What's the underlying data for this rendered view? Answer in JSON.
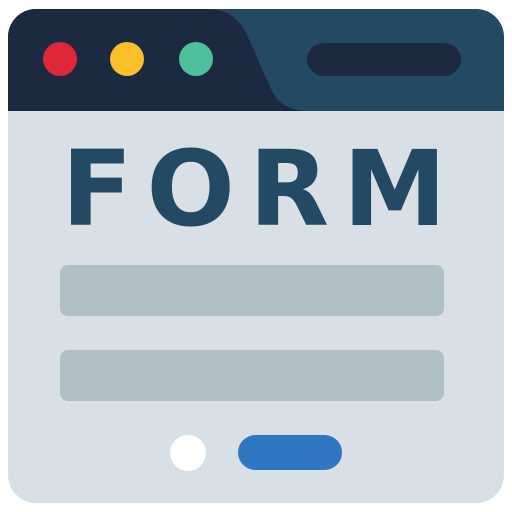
{
  "window": {
    "title": "FORM",
    "colors": {
      "body": "#d8e0e6",
      "titlebar_dark": "#1b2a40",
      "titlebar_light": "#234a62",
      "title_text": "#234a62",
      "field": "#afbfc5",
      "radio": "#ffffff",
      "submit": "#2f77c2"
    }
  },
  "controls": {
    "close_color": "#de2839",
    "minimize_color": "#fbbf2a",
    "maximize_color": "#4fc09c",
    "address_bar_color": "#1b2a40"
  },
  "icons": {
    "close": "red-dot-icon",
    "minimize": "yellow-dot-icon",
    "maximize": "green-dot-icon"
  }
}
